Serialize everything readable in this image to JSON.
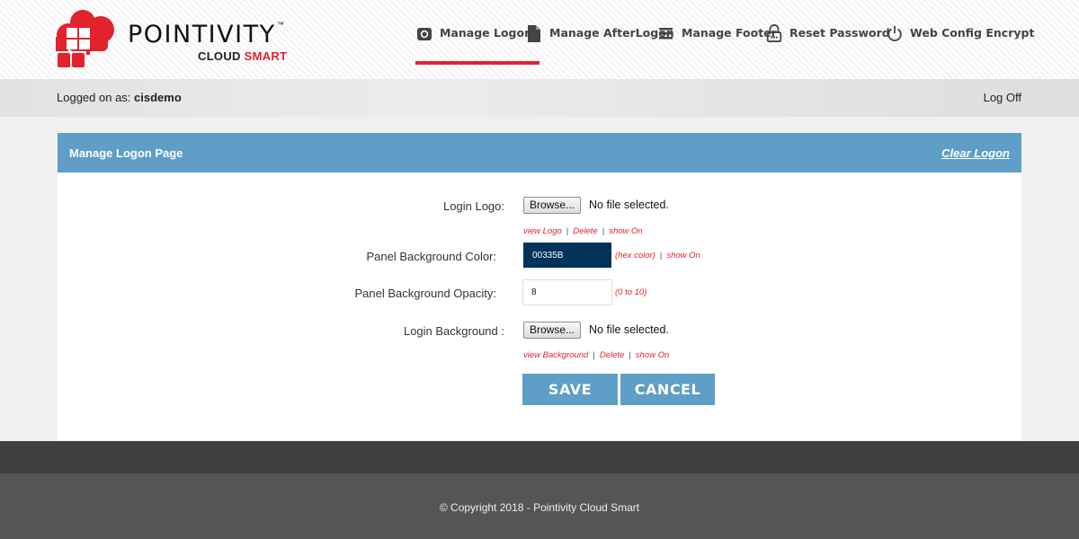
{
  "brand": {
    "name": "POINTIVITY",
    "trademark": "™",
    "sub_a": "CLOUD ",
    "sub_b": "SMART",
    "colors": {
      "primary_red": "#e4222d",
      "dark": "#111111"
    }
  },
  "nav": [
    {
      "label": "Manage Logon",
      "icon": "camera-icon",
      "active": true
    },
    {
      "label": "Manage AfterLogon",
      "icon": "document-icon",
      "active": false
    },
    {
      "label": "Manage Footer",
      "icon": "menu-lines-icon",
      "active": false
    },
    {
      "label": "Reset Password",
      "icon": "lock-icon",
      "active": false
    },
    {
      "label": "Web Config Encrypt",
      "icon": "power-icon",
      "active": false
    }
  ],
  "userbar": {
    "logged_prefix": "Logged on as: ",
    "username": "cisdemo",
    "logoff": "Log Off"
  },
  "panel": {
    "title": "Manage Logon Page",
    "clear": "Clear Logon",
    "header_color": "#5f9ec6"
  },
  "form": {
    "login_logo": {
      "label": "Login Logo:",
      "browse": "Browse...",
      "status": "No file selected.",
      "links": [
        "view Logo",
        "Delete",
        "show On"
      ]
    },
    "panel_bg_color": {
      "label": "Panel Background Color:",
      "value": "00335B",
      "swatch": "#00335b",
      "hint": "(hex color)",
      "link": "show On"
    },
    "panel_bg_opacity": {
      "label": "Panel Background Opacity:",
      "value": "8",
      "hint": "(0 to 10)"
    },
    "login_bg": {
      "label": "Login Background :",
      "browse": "Browse...",
      "status": "No file selected.",
      "links": [
        "view Background",
        "Delete",
        "show On"
      ]
    },
    "save": "SAVE",
    "cancel": "CANCEL"
  },
  "footer": {
    "copyright": "© Copyright 2018 - Pointivity Cloud Smart"
  }
}
